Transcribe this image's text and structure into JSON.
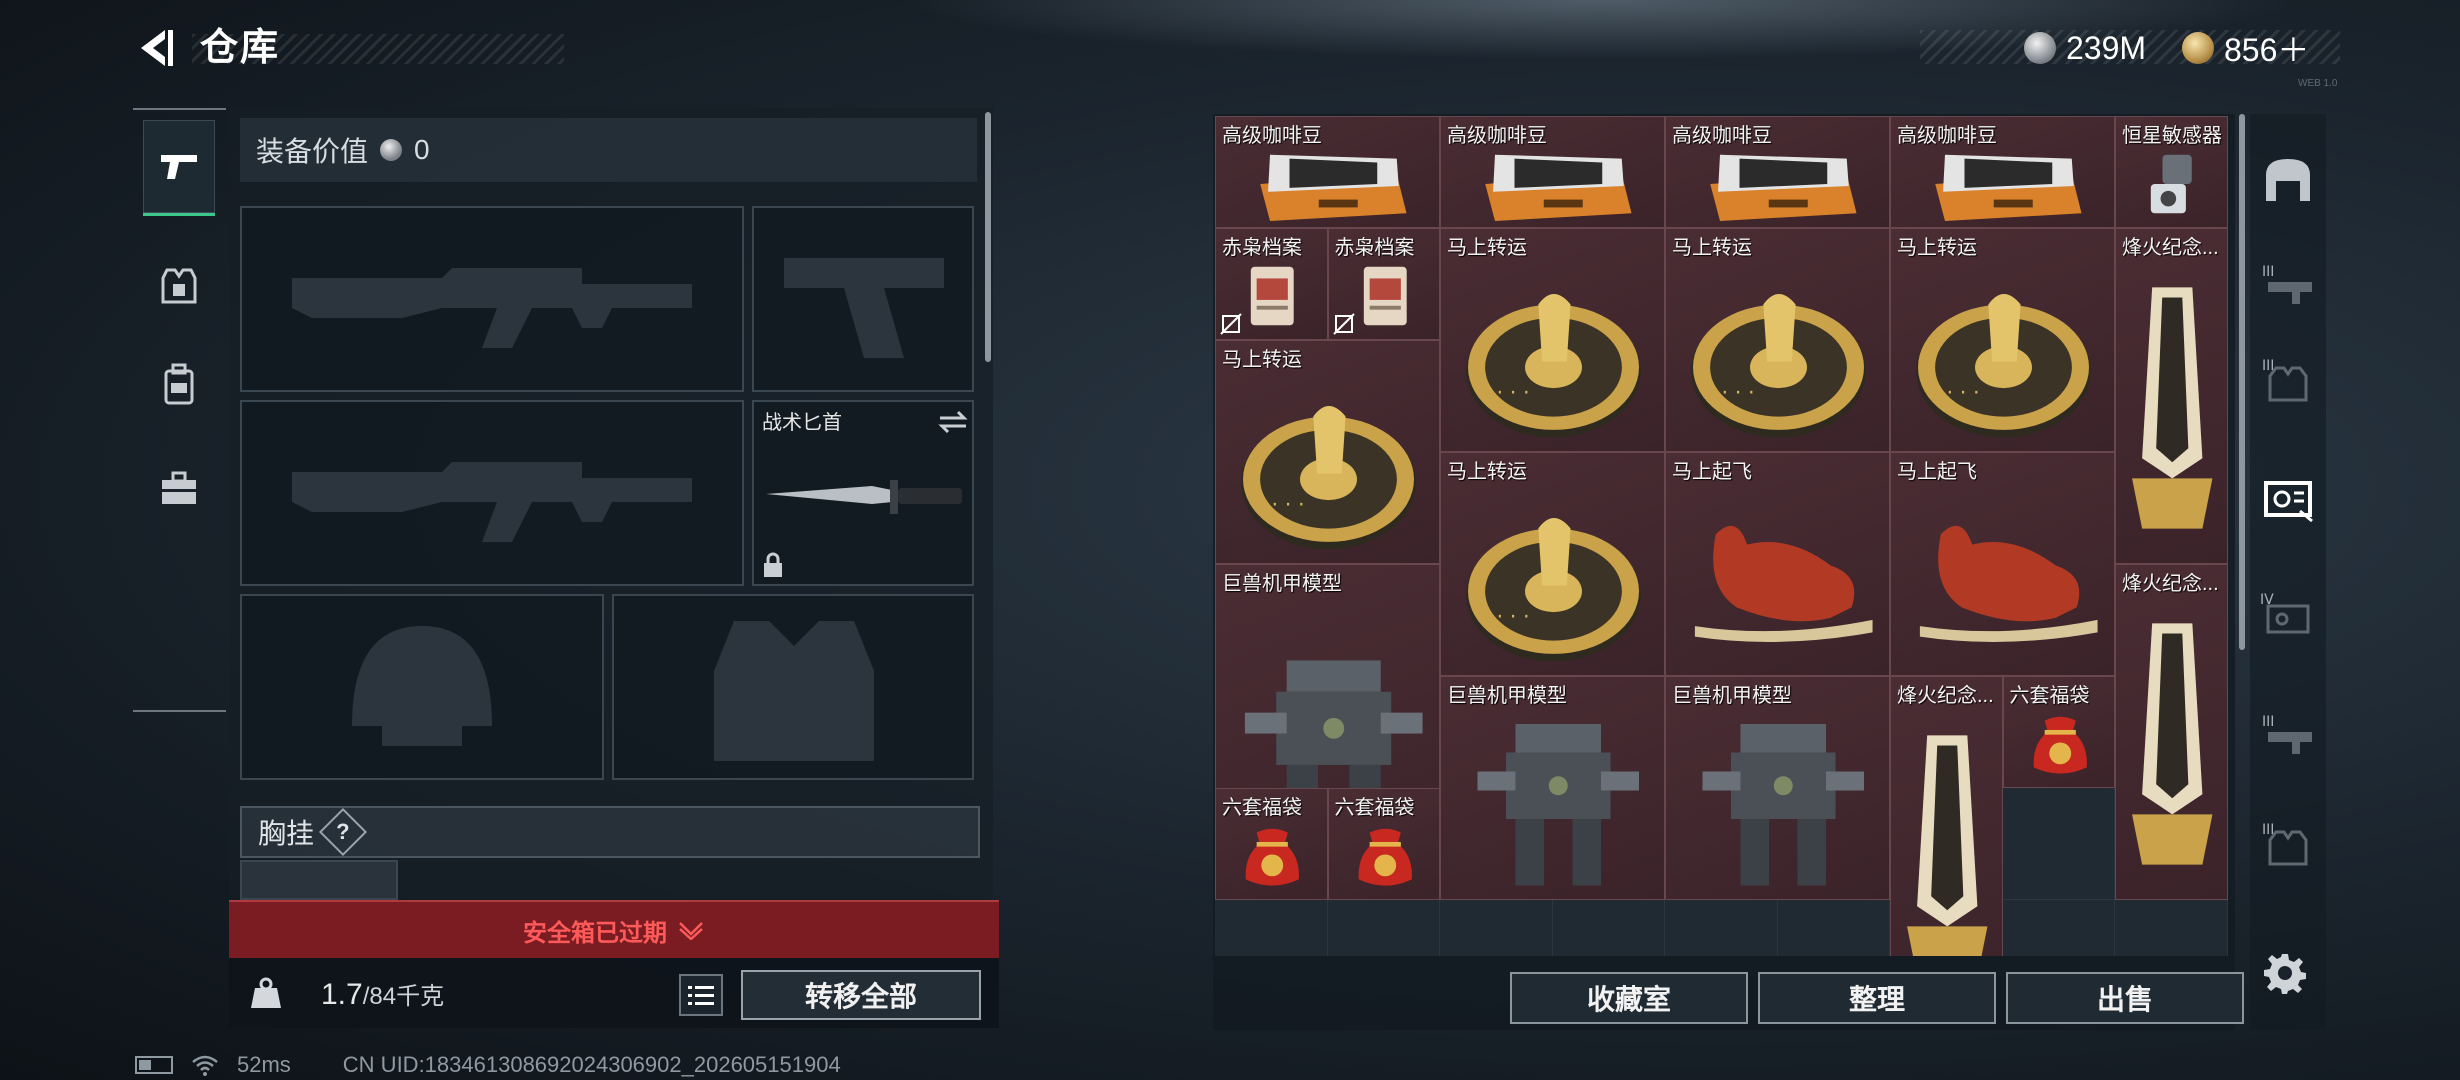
{
  "header": {
    "title": "仓库",
    "currency_silver": "239M",
    "currency_gold": "856＋",
    "tiny_text": "WEB 1.0"
  },
  "equipment": {
    "value_label": "装备价值",
    "value": "0",
    "knife_label": "战术匕首",
    "chest_rig_label": "胸挂",
    "help_symbol": "?",
    "safe_box_text": "安全箱已过期",
    "weight_value": "1.7",
    "weight_capacity": "/84千克",
    "move_all_label": "转移全部"
  },
  "stash": {
    "items": [
      {
        "label": "高级咖啡豆",
        "icon": "coffee-beans"
      },
      {
        "label": "高级咖啡豆",
        "icon": "coffee-beans"
      },
      {
        "label": "高级咖啡豆",
        "icon": "coffee-beans"
      },
      {
        "label": "高级咖啡豆",
        "icon": "coffee-beans"
      },
      {
        "label": "恒星敏感器",
        "icon": "sensor"
      },
      {
        "label": "赤枭档案",
        "icon": "file"
      },
      {
        "label": "赤枭档案",
        "icon": "file"
      },
      {
        "label": "马上转运",
        "icon": "horse-coin"
      },
      {
        "label": "马上转运",
        "icon": "horse-coin"
      },
      {
        "label": "马上转运",
        "icon": "horse-coin"
      },
      {
        "label": "烽火纪念...",
        "icon": "trophy"
      },
      {
        "label": "马上转运",
        "icon": "horse-coin"
      },
      {
        "label": "马上转运",
        "icon": "horse-coin"
      },
      {
        "label": "马上起飞",
        "icon": "red-horse"
      },
      {
        "label": "马上起飞",
        "icon": "red-horse"
      },
      {
        "label": "巨兽机甲模型",
        "icon": "mech"
      },
      {
        "label": "烽火纪念...",
        "icon": "trophy"
      },
      {
        "label": "巨兽机甲模型",
        "icon": "mech"
      },
      {
        "label": "巨兽机甲模型",
        "icon": "mech"
      },
      {
        "label": "烽火纪念...",
        "icon": "trophy"
      },
      {
        "label": "六套福袋",
        "icon": "lucky-bag"
      },
      {
        "label": "六套福袋",
        "icon": "lucky-bag"
      },
      {
        "label": "六套福袋",
        "icon": "lucky-bag"
      }
    ],
    "buttons": {
      "collection": "收藏室",
      "organize": "整理",
      "sell": "出售"
    }
  },
  "status": {
    "ping": "52ms",
    "uid": "CN UID:183461308692024306902_202605151904"
  },
  "colors": {
    "accent_green": "#3ec78c",
    "alert_red": "#ff5a5a",
    "item_bg": "#3a262c"
  }
}
